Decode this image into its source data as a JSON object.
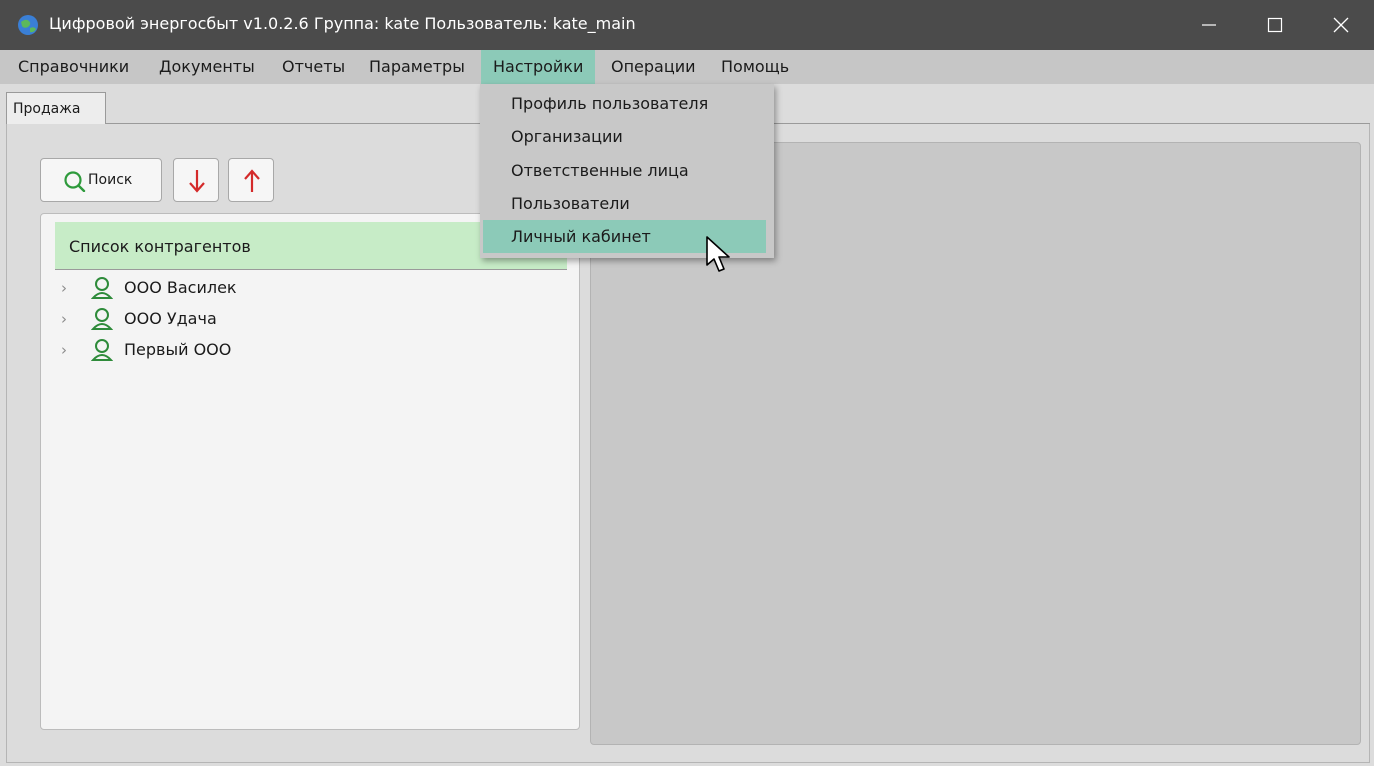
{
  "window": {
    "title": "Цифровой энергосбыт v1.0.2.6 Группа: kate Пользователь: kate_main",
    "icons": {
      "app": "globe-icon",
      "minimize": "minimize-icon",
      "maximize": "maximize-icon",
      "close": "close-icon"
    }
  },
  "menubar": {
    "items": [
      {
        "label": "Справочники"
      },
      {
        "label": "Документы"
      },
      {
        "label": "Отчеты"
      },
      {
        "label": "Параметры"
      },
      {
        "label": "Настройки",
        "active": true
      },
      {
        "label": "Операции"
      },
      {
        "label": "Помощь"
      }
    ]
  },
  "dropdown": {
    "items": [
      {
        "label": "Профиль пользователя"
      },
      {
        "label": "Организации"
      },
      {
        "label": "Ответственные лица"
      },
      {
        "label": "Пользователи"
      },
      {
        "label": "Личный кабинет",
        "highlighted": true
      }
    ]
  },
  "tabs": [
    {
      "label": "Продажа",
      "active": true
    }
  ],
  "toolbar": {
    "search_label": "Поиск",
    "icons": {
      "search": "search-icon",
      "down": "arrow-down-icon",
      "up": "arrow-up-icon"
    }
  },
  "list": {
    "header": "Список контрагентов",
    "items": [
      {
        "label": "ООО Василек"
      },
      {
        "label": "ООО Удача"
      },
      {
        "label": "Первый ООО"
      }
    ]
  },
  "colors": {
    "titlebar": "#4b4b4b",
    "menu_active": "#8ccab8",
    "list_header": "#c7ecc7",
    "user_icon": "#2e8b3a",
    "arrow_red": "#d42a2a",
    "search_green": "#2e9a3c"
  }
}
